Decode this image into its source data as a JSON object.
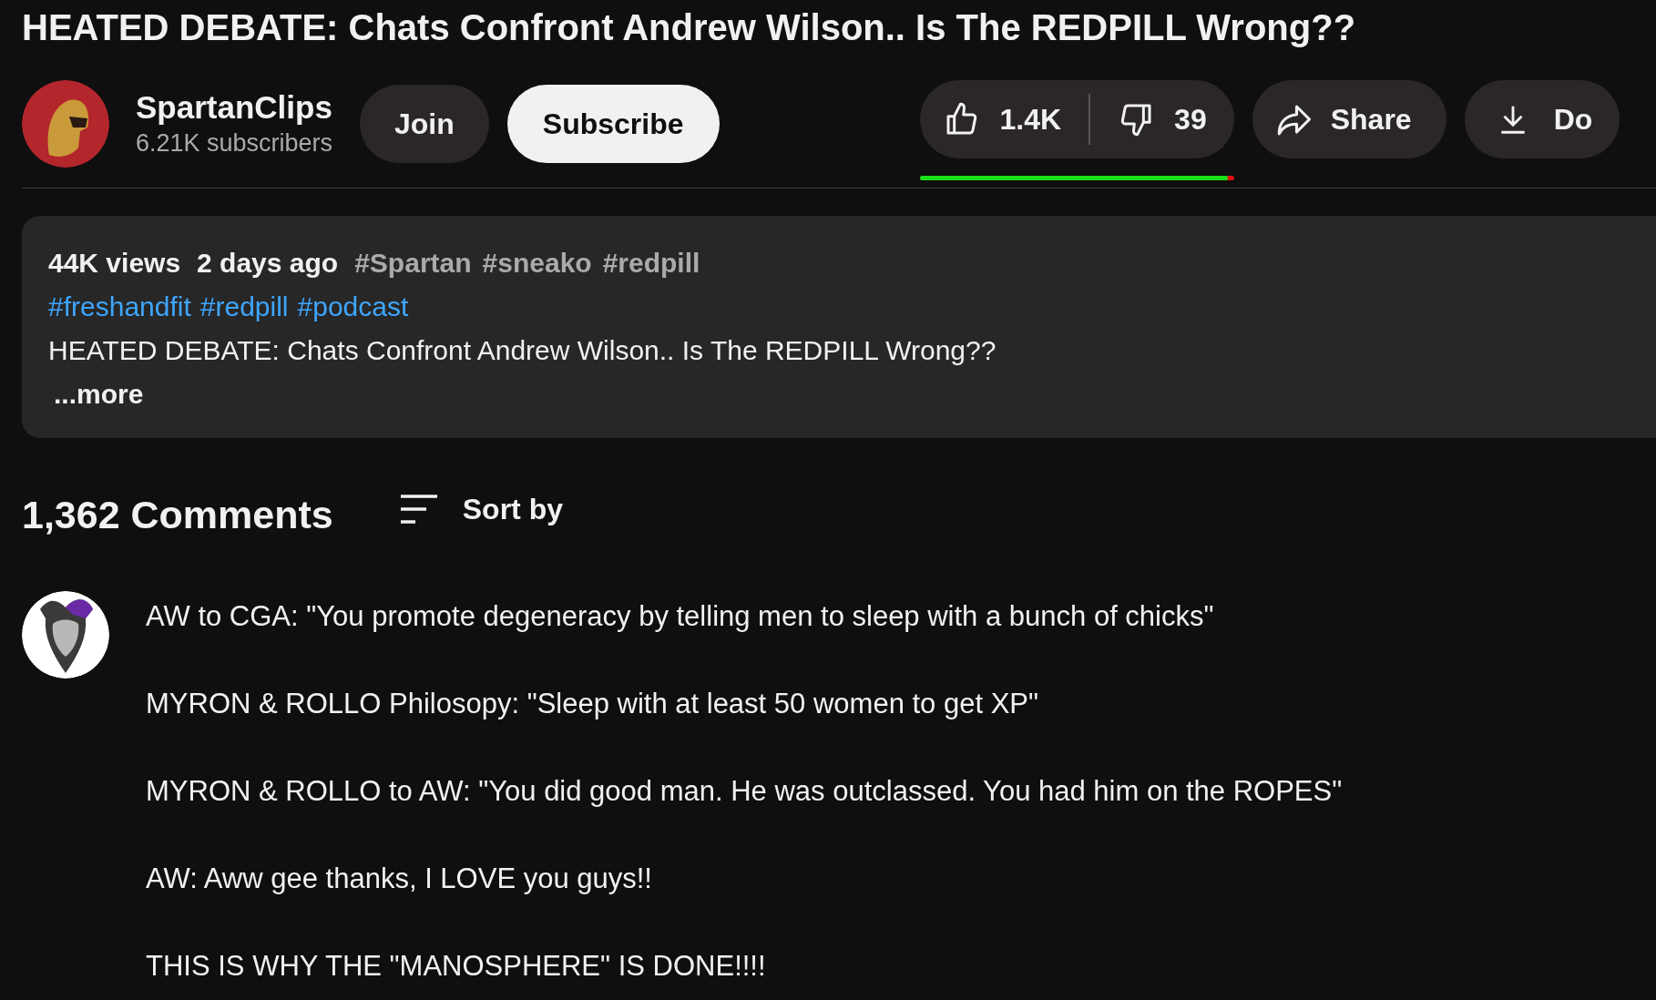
{
  "video": {
    "title": "HEATED DEBATE: Chats Confront Andrew Wilson.. Is The REDPILL Wrong??"
  },
  "channel": {
    "name": "SpartanClips",
    "subscribers": "6.21K subscribers",
    "join": "Join",
    "subscribe": "Subscribe"
  },
  "actions": {
    "likes": "1.4K",
    "dislikes": "39",
    "rating": {
      "level": 0.98
    },
    "share": "Share",
    "download": "Do"
  },
  "description": {
    "views": "44K views",
    "date": "2 days ago",
    "top_tags": [
      "#Spartan",
      "#sneako",
      "#redpill"
    ],
    "tags": [
      "#freshandfit",
      "#redpill",
      "#podcast"
    ],
    "text": "HEATED DEBATE: Chats Confront Andrew Wilson.. Is The REDPILL Wrong??",
    "more": "...more"
  },
  "comments": {
    "count": "1,362 Comments",
    "sort": "Sort by",
    "draft": {
      "lines": [
        "AW to CGA: \"You promote degeneracy by telling men to sleep with a bunch of chicks\"",
        "MYRON & ROLLO Philosopy: \"Sleep with at least 50 women to get XP\"",
        "MYRON & ROLLO to AW: \"You did good man. He was outclassed. You had him on the ROPES\"",
        "AW: Aww gee thanks, I LOVE you guys!!",
        "THIS IS WHY THE \"MANOSPHERE\" IS DONE!!!!"
      ]
    }
  }
}
